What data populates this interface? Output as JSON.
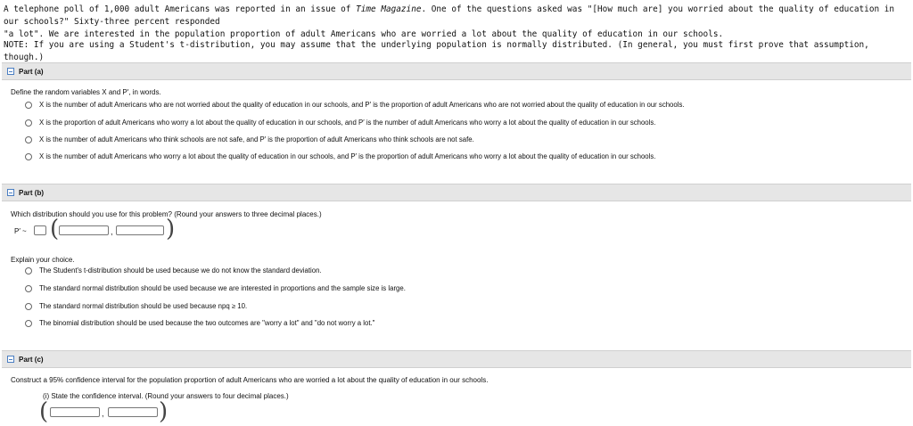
{
  "intro": {
    "line1_pre": "A telephone poll of 1,000 adult Americans was reported in an issue of ",
    "magazine": "Time Magazine",
    "line1_post": ". One of the questions asked was \"[How much are] you worried about the quality of education in our schools?\" Sixty-three percent responded",
    "line2": "\"a lot\". We are interested in the population proportion of adult Americans who are worried a lot about the quality of education in our schools."
  },
  "note": "NOTE: If you are using a Student's t-distribution, you may assume that the underlying population is normally distributed. (In general, you must first prove that assumption, though.)",
  "part_a": {
    "title": "Part (a)",
    "question": "Define the random variables X and P′, in words.",
    "options": [
      "X is the number of adult Americans who are not worried about the quality of education in our schools, and P′ is the proportion of adult Americans who are not worried about the quality of education in our schools.",
      "X is the proportion of adult Americans who worry a lot about the quality of education in our schools, and P′ is the number of adult Americans who worry a lot about the quality of education in our schools.",
      "X is the number of adult Americans who think schools are not safe, and P′ is the proportion of adult Americans who think schools are not safe.",
      "X is the number of adult Americans who worry a lot about the quality of education in our schools, and P′ is the proportion of adult Americans who worry a lot about the quality of education in our schools."
    ]
  },
  "part_b": {
    "title": "Part (b)",
    "question": "Which distribution should you use for this problem? (Round your answers to three decimal places.)",
    "p_label": "P′ ~",
    "dist_value": "",
    "mean_value": "",
    "sd_value": "",
    "explain": "Explain your choice.",
    "options": [
      "The Student's t-distribution should be used because we do not know the standard deviation.",
      "The standard normal distribution should be used because we are interested in proportions and the sample size is large.",
      "The standard normal distribution should be used because npq ≥ 10.",
      "The binomial distribution should be used because the two outcomes are \"worry a lot\" and \"do not worry a lot.\""
    ]
  },
  "part_c": {
    "title": "Part (c)",
    "question": "Construct a 95% confidence interval for the population proportion of adult Americans who are worried a lot about the quality of education in our schools.",
    "sub": "(i) State the confidence interval. (Round your answers to four decimal places.)",
    "lower_value": "",
    "upper_value": ""
  }
}
